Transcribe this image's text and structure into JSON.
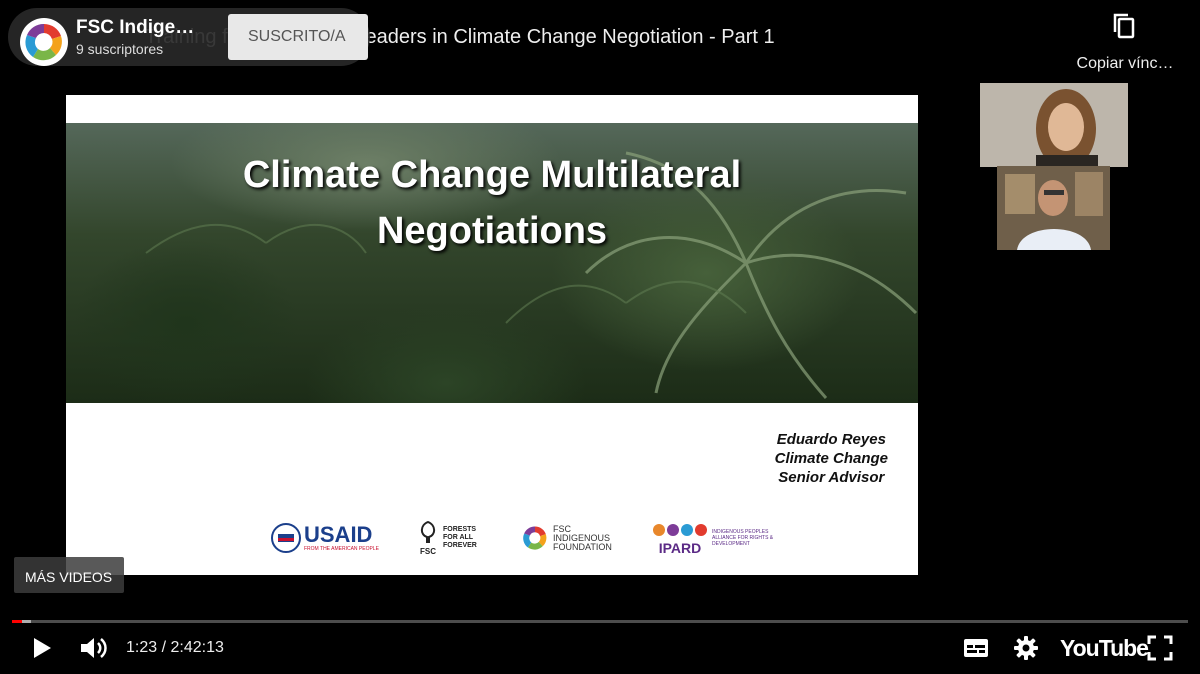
{
  "video": {
    "title": "Training for Indigenous Leaders in Climate Change Negotiation - Part 1"
  },
  "channel": {
    "name": "FSC Indige…",
    "subscribers": "9 suscriptores",
    "subscribe_label": "SUSCRITO/A"
  },
  "top_actions": {
    "copy_link_label": "Copiar vínc…"
  },
  "slide": {
    "title_line1": "Climate Change Multilateral",
    "title_line2": "Negotiations",
    "presenter_name": "Eduardo Reyes",
    "presenter_role1": "Climate Change",
    "presenter_role2": "Senior Advisor",
    "logos": {
      "usaid": "USAID",
      "usaid_sub": "FROM THE AMERICAN PEOPLE",
      "fsc": "FSC",
      "fsc_tag": "FORESTS FOR ALL FOREVER",
      "fsc_if_line1": "FSC",
      "fsc_if_line2": "INDIGENOUS",
      "fsc_if_line3": "FOUNDATION",
      "ipard": "IPARD",
      "ipard_sub": "INDIGENOUS PEOPLES ALLIANCE FOR RIGHTS & DEVELOPMENT"
    }
  },
  "overlay": {
    "more_videos": "MÁS VIDEOS"
  },
  "player": {
    "time_display": "1:23 / 2:42:13",
    "played_fraction": 0.0085,
    "buffered_fraction": 0.016,
    "youtube_label": "YouTube",
    "accent_color": "#ff0000"
  },
  "icons": [
    "play-icon",
    "volume-icon",
    "subtitles-icon",
    "settings-gear-icon",
    "fullscreen-icon",
    "copy-icon"
  ]
}
